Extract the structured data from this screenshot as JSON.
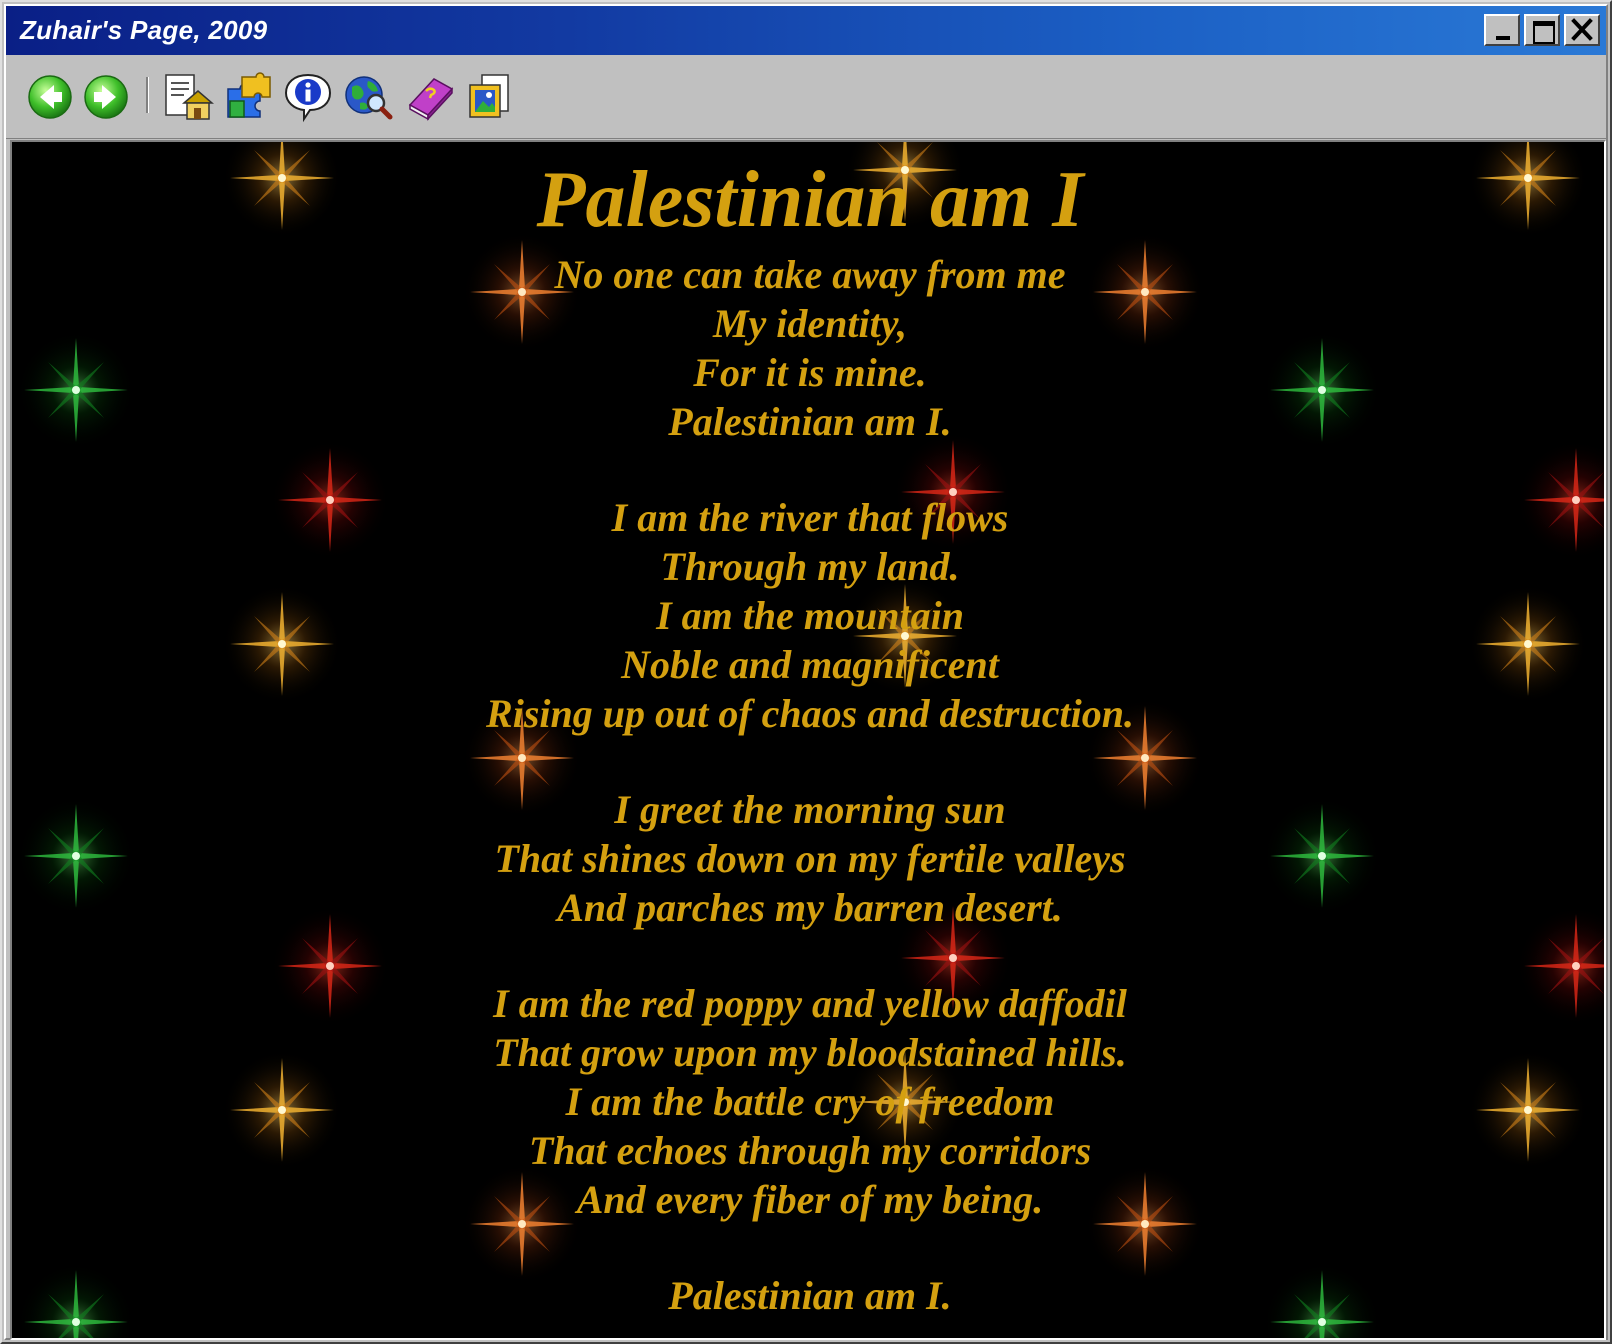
{
  "window": {
    "title": "Zuhair's Page, 2009"
  },
  "toolbar": {
    "buttons": [
      {
        "name": "back",
        "icon": "back-arrow-icon"
      },
      {
        "name": "forward",
        "icon": "forward-arrow-icon"
      },
      {
        "name": "home",
        "icon": "home-page-icon"
      },
      {
        "name": "links",
        "icon": "puzzle-links-icon"
      },
      {
        "name": "info",
        "icon": "info-icon"
      },
      {
        "name": "web",
        "icon": "globe-search-icon"
      },
      {
        "name": "guestbook",
        "icon": "book-icon"
      },
      {
        "name": "gallery",
        "icon": "picture-frame-icon"
      }
    ]
  },
  "colors": {
    "title_bar_start": "#0a1f86",
    "title_bar_end": "#2a79d6",
    "poem_text": "#d4a010",
    "page_background": "#000000"
  },
  "poem": {
    "title": "Palestinian am I",
    "stanza1": [
      "No one can take away from me",
      "My identity,",
      "For it is mine.",
      "Palestinian am I."
    ],
    "stanza2": [
      "I am the river that flows",
      "Through my land.",
      "I am the mountain",
      "Noble and magnificent",
      "Rising up out of chaos and destruction."
    ],
    "stanza3": [
      "I greet the morning sun",
      "That shines down on my fertile valleys",
      "And parches my barren desert."
    ],
    "stanza4": [
      "I am the red poppy and yellow daffodil",
      "That grow upon my bloodstained hills.",
      "I am the battle cry of freedom",
      "That echoes through my corridors",
      "And every fiber of my being."
    ],
    "stanza5": [
      "Palestinian am I."
    ]
  }
}
